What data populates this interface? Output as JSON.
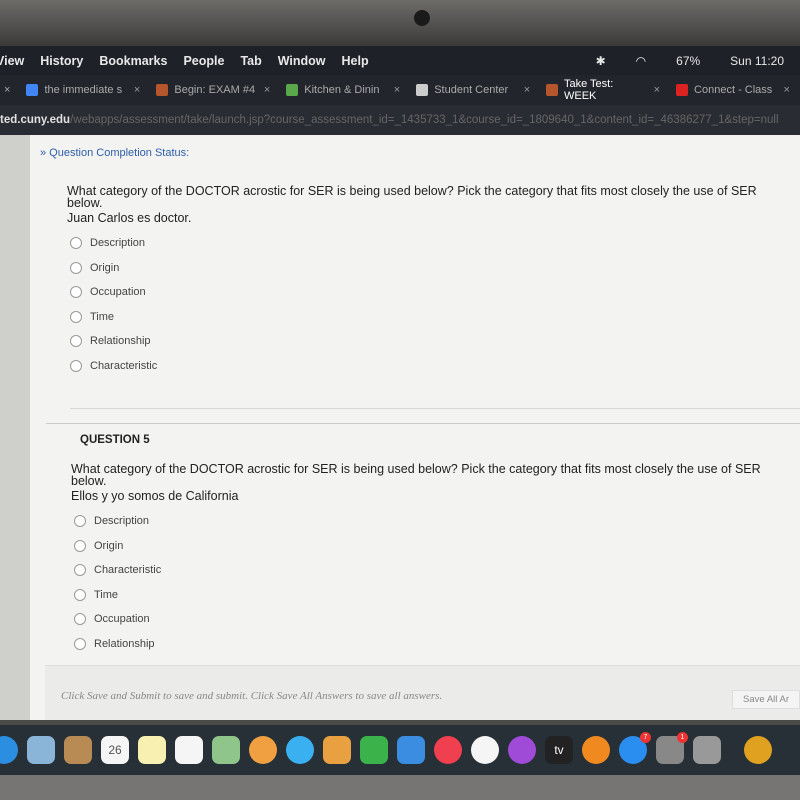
{
  "menubar": {
    "items": [
      "View",
      "History",
      "Bookmarks",
      "People",
      "Tab",
      "Window",
      "Help"
    ],
    "battery": "67%",
    "clock": "Sun 11:20"
  },
  "tabs": [
    {
      "title": "the immediate s",
      "color": "#4285f4"
    },
    {
      "title": "Begin: EXAM #4",
      "color": "#b5562c"
    },
    {
      "title": "Kitchen & Dinin",
      "color": "#5aa84a"
    },
    {
      "title": "Student Center",
      "color": "#cccccc"
    },
    {
      "title": "Take Test: WEEK",
      "color": "#b5562c",
      "active": true
    },
    {
      "title": "Connect - Class",
      "color": "#d22"
    }
  ],
  "url": {
    "host": "ted.cuny.edu",
    "path": "/webapps/assessment/take/launch.jsp?course_assessment_id=_1435733_1&course_id=_1809640_1&content_id=_46386277_1&step=null"
  },
  "page": {
    "completion_status": "» Question Completion Status:",
    "q4": {
      "text": "What category of the DOCTOR acrostic for SER is being used below? Pick the category that fits most closely the use of SER below.",
      "sentence": "Juan Carlos es doctor.",
      "options": [
        "Description",
        "Origin",
        "Occupation",
        "Time",
        "Relationship",
        "Characteristic"
      ]
    },
    "q5": {
      "heading": "QUESTION 5",
      "text": "What category of the DOCTOR acrostic for SER is being used below? Pick the category that fits most closely the use of SER below.",
      "sentence": "Ellos y yo somos de California",
      "options": [
        "Description",
        "Origin",
        "Characteristic",
        "Time",
        "Occupation",
        "Relationship"
      ]
    },
    "footer_note": "Click Save and Submit to save and submit. Click Save All Answers to save all answers.",
    "save_all_button": "Save All Ar"
  },
  "dock": {
    "icons": [
      {
        "name": "safari",
        "color": "#2b8ee0"
      },
      {
        "name": "mail",
        "color": "#8ab4d8"
      },
      {
        "name": "contacts",
        "color": "#b88b55"
      },
      {
        "name": "calendar",
        "color": "#f5f5f5",
        "label": "26"
      },
      {
        "name": "notes",
        "color": "#f7f0b0"
      },
      {
        "name": "reminders",
        "color": "#f5f5f5"
      },
      {
        "name": "maps",
        "color": "#8fc48a"
      },
      {
        "name": "photos",
        "color": "#f0a040"
      },
      {
        "name": "messages",
        "color": "#3ab0f0"
      },
      {
        "name": "pages",
        "color": "#e8a040"
      },
      {
        "name": "numbers",
        "color": "#3bb34a"
      },
      {
        "name": "keynote",
        "color": "#3a8de0"
      },
      {
        "name": "news",
        "color": "#f04050"
      },
      {
        "name": "music",
        "color": "#f5f5f5"
      },
      {
        "name": "podcasts",
        "color": "#a04ad8"
      },
      {
        "name": "tv",
        "color": "#222222",
        "label": "tv"
      },
      {
        "name": "books",
        "color": "#f08a20"
      },
      {
        "name": "app-store",
        "color": "#2a8df0",
        "badge": "7"
      },
      {
        "name": "system-preferences",
        "color": "#888888",
        "badge": "1"
      },
      {
        "name": "utility",
        "color": "#999999"
      },
      {
        "name": "chrome",
        "color": "#e0a020"
      }
    ]
  }
}
